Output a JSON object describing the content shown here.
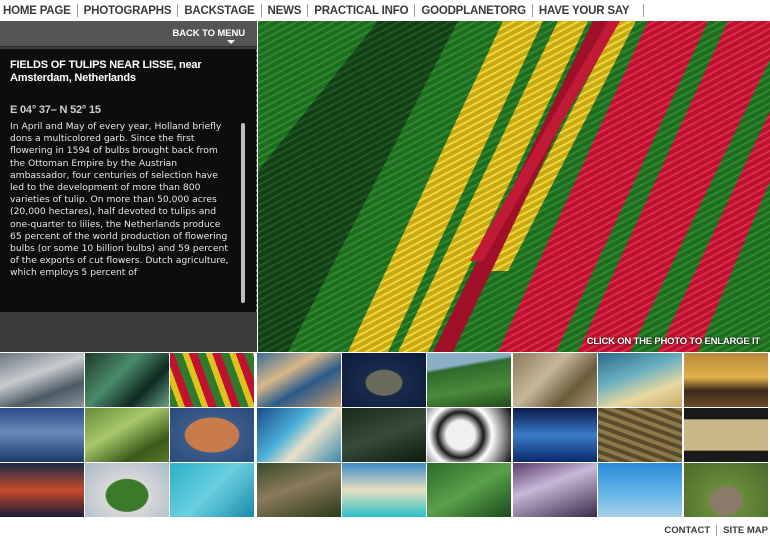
{
  "nav": {
    "items": [
      {
        "label": "HOME PAGE"
      },
      {
        "label": "PHOTOGRAPHS"
      },
      {
        "label": "BACKSTAGE"
      },
      {
        "label": "NEWS"
      },
      {
        "label": "PRACTICAL INFO"
      },
      {
        "label": "GOODPLANETORG"
      },
      {
        "label": "HAVE YOUR SAY"
      }
    ]
  },
  "panel": {
    "back_label": "BACK TO MENU",
    "title": "FIELDS OF TULIPS NEAR LISSE, near Amsterdam, Netherlands",
    "coords": "E 04° 37– N 52° 15",
    "description": "In April and May of every year, Holland briefly dons a multicolored garb. Since the first flowering in 1594 of bulbs brought back from the Ottoman Empire by the Austrian ambassador, four centuries of selection have led to the development of more than 800 varieties of tulip. On more than 50,000 acres (20,000 hectares), half devoted to tulips and one-quarter to lilies, the Netherlands produce 65 percent of the world production of flowering bulbs (or some 10 billion bulbs) and 59 percent of the exports of cut flowers. Dutch agriculture, which employs 5 percent of"
  },
  "photo": {
    "enlarge_label": "CLICK ON THE PHOTO TO ENLARGE IT"
  },
  "colors": {
    "tulip_green": "#1f6b22",
    "tulip_yellow": "#e0c21c",
    "tulip_red": "#d11a3a",
    "panel_dark": "#0d0d0d",
    "panel_gray": "#3c3c3c"
  },
  "footer": {
    "contact_label": "CONTACT",
    "sitemap_label": "SITE MAP"
  }
}
